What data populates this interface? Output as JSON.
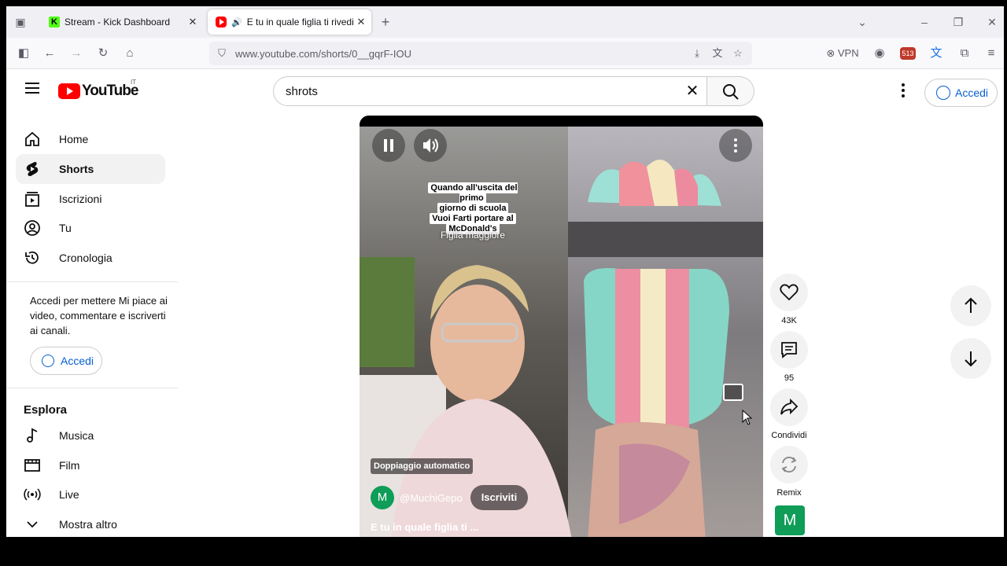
{
  "browser": {
    "tabs": [
      {
        "title": "Stream - Kick Dashboard",
        "active": false
      },
      {
        "title": "E tu in quale figlia ti rivedi#",
        "active": true
      }
    ],
    "new_tab": "+",
    "url": "www.youtube.com/shorts/0__gqrF-IOU",
    "vpn_label": "VPN",
    "extension_badge": "513"
  },
  "youtube": {
    "logo_text": "YouTube",
    "region": "IT",
    "search": {
      "value": "shrots"
    },
    "signin_label": "Accedi"
  },
  "sidebar": {
    "items": [
      {
        "label": "Home",
        "icon": "home-icon"
      },
      {
        "label": "Shorts",
        "icon": "shorts-icon"
      },
      {
        "label": "Iscrizioni",
        "icon": "subscriptions-icon"
      },
      {
        "label": "Tu",
        "icon": "you-icon"
      },
      {
        "label": "Cronologia",
        "icon": "history-icon"
      }
    ],
    "signin_message": "Accedi per mettere Mi piace ai video, commentare e iscriverti ai canali.",
    "signin_label": "Accedi",
    "explore_title": "Esplora",
    "explore_items": [
      {
        "label": "Musica",
        "icon": "music-icon"
      },
      {
        "label": "Film",
        "icon": "film-icon"
      },
      {
        "label": "Live",
        "icon": "live-icon"
      },
      {
        "label": "Mostra altro",
        "icon": "chevron-down-icon"
      }
    ]
  },
  "video": {
    "overlay_lines": [
      "Quando all'uscita del primo",
      "giorno di scuola",
      "Vuoi Farti portare al",
      "McDonald's"
    ],
    "overlay_sub": "Figlia maggiore",
    "dub_badge": "Doppiaggio automatico",
    "channel_initial": "M",
    "channel_handle": "@MuchiGepo",
    "subscribe_label": "Iscriviti",
    "title": "E tu in quale figlia ti ..."
  },
  "actions": {
    "likes": "43K",
    "comments": "95",
    "share_label": "Condividi",
    "remix_label": "Remix",
    "channel_initial": "M"
  },
  "colors": {
    "yt_red": "#ff0000",
    "link_blue": "#065fd4",
    "channel_green": "#0f9d58"
  }
}
